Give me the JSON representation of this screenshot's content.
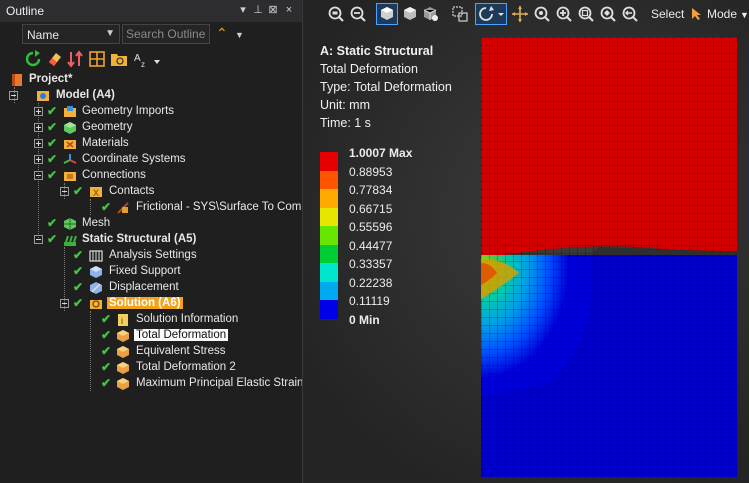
{
  "outline": {
    "title": "Outline",
    "title_buttons": [
      "▾",
      "⊥",
      "⊠",
      "×"
    ],
    "filter_value": "Name",
    "search_placeholder": "Search Outline"
  },
  "tree": [
    {
      "label": "Project*",
      "level": 0,
      "bold": true,
      "icon": "project-icon",
      "check": false,
      "expander": "none"
    },
    {
      "label": "Model (A4)",
      "level": 1,
      "bold": true,
      "icon": "model-icon",
      "check": false,
      "expander": "minus"
    },
    {
      "label": "Geometry Imports",
      "level": 2,
      "icon": "geometry-imports-icon",
      "check": true,
      "expander": "plus"
    },
    {
      "label": "Geometry",
      "level": 2,
      "icon": "geometry-icon",
      "check": true,
      "expander": "plus"
    },
    {
      "label": "Materials",
      "level": 2,
      "icon": "materials-icon",
      "check": true,
      "expander": "plus"
    },
    {
      "label": "Coordinate Systems",
      "level": 2,
      "icon": "coordinate-systems-icon",
      "check": true,
      "expander": "plus"
    },
    {
      "label": "Connections",
      "level": 2,
      "icon": "connections-icon",
      "check": true,
      "expander": "minus"
    },
    {
      "label": "Contacts",
      "level": 3,
      "icon": "contacts-icon",
      "check": true,
      "expander": "minus"
    },
    {
      "label": "Frictional - SYS\\Surface To Compo",
      "level": 4,
      "icon": "frictional-contact-icon",
      "check": true,
      "expander": "none"
    },
    {
      "label": "Mesh",
      "level": 2,
      "icon": "mesh-icon",
      "check": true,
      "expander": "none"
    },
    {
      "label": "Static Structural (A5)",
      "level": 2,
      "bold": true,
      "icon": "static-structural-icon",
      "check": true,
      "expander": "minus"
    },
    {
      "label": "Analysis Settings",
      "level": 3,
      "icon": "analysis-settings-icon",
      "check": true,
      "expander": "none"
    },
    {
      "label": "Fixed Support",
      "level": 3,
      "icon": "fixed-support-icon",
      "check": true,
      "expander": "none"
    },
    {
      "label": "Displacement",
      "level": 3,
      "icon": "displacement-icon",
      "check": true,
      "expander": "none"
    },
    {
      "label": "Solution (A6)",
      "level": 3,
      "bold": true,
      "highlight": "orange",
      "icon": "solution-icon",
      "check": true,
      "expander": "minus"
    },
    {
      "label": "Solution Information",
      "level": 4,
      "icon": "solution-information-icon",
      "check": true,
      "expander": "none"
    },
    {
      "label": "Total Deformation",
      "level": 4,
      "highlight": "white",
      "icon": "result-icon",
      "check": true,
      "expander": "none"
    },
    {
      "label": "Equivalent Stress",
      "level": 4,
      "icon": "result-icon",
      "check": true,
      "expander": "none"
    },
    {
      "label": "Total Deformation 2",
      "level": 4,
      "icon": "result-icon",
      "check": true,
      "expander": "none"
    },
    {
      "label": "Maximum Principal Elastic Strain",
      "level": 4,
      "icon": "result-icon",
      "check": true,
      "expander": "none"
    }
  ],
  "viewport": {
    "select_label": "Select",
    "mode_label": "Mode",
    "result": {
      "title": "A: Static Structural",
      "name": "Total Deformation",
      "type": "Type: Total Deformation",
      "unit": "Unit: mm",
      "time": "Time: 1 s"
    },
    "legend": [
      {
        "label": "1.0007 Max",
        "color": "#e60000",
        "bold": true
      },
      {
        "label": "0.88953",
        "color": "#ff5500"
      },
      {
        "label": "0.77834",
        "color": "#ffaa00"
      },
      {
        "label": "0.66715",
        "color": "#e6e600"
      },
      {
        "label": "0.55596",
        "color": "#66e600"
      },
      {
        "label": "0.44477",
        "color": "#00cc33"
      },
      {
        "label": "0.33357",
        "color": "#00e6cc"
      },
      {
        "label": "0.22238",
        "color": "#00aaee"
      },
      {
        "label": "0.11119",
        "color": "#0055ff"
      },
      {
        "label": "0 Min",
        "color": "#0000e6",
        "bold": true
      }
    ]
  }
}
